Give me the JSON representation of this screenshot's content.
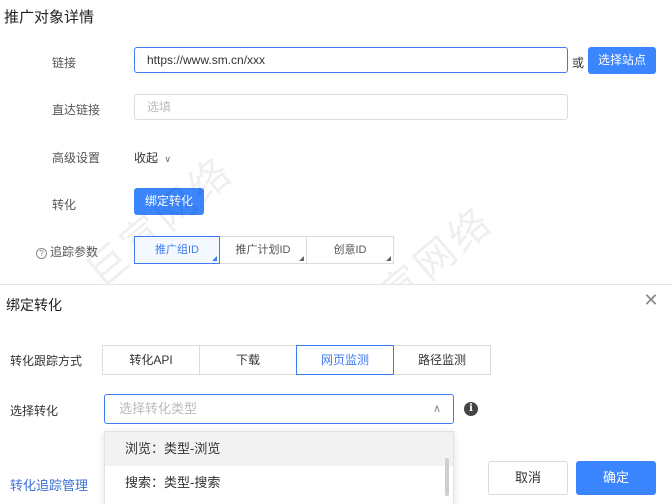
{
  "page_title": "推广对象详情",
  "form": {
    "link_label": "链接",
    "link_value": "https://www.sm.cn/xxx",
    "or_text": "或",
    "select_site_label": "选择站点",
    "direct_label": "直达链接",
    "direct_placeholder": "选填",
    "advanced_label": "高级设置",
    "advanced_toggle": "收起",
    "convert_label": "转化",
    "bind_convert_label": "绑定转化",
    "track_label": "追踪参数",
    "track_params": [
      "推广组ID",
      "推广计划ID",
      "创意ID"
    ]
  },
  "watermark": "巨宣网络",
  "dialog": {
    "title": "绑定转化",
    "method_label": "转化跟踪方式",
    "methods": [
      "转化API",
      "下载",
      "网页监测",
      "路径监测"
    ],
    "active_method": "网页监测",
    "select_label": "选择转化",
    "select_placeholder": "选择转化类型",
    "options": [
      "浏览：类型-浏览",
      "搜索：类型-搜索"
    ],
    "manage_link": "转化追踪管理",
    "cancel": "取消",
    "confirm": "确定"
  },
  "colors": {
    "accent": "#3b86ff",
    "link": "#3b6fd8"
  }
}
